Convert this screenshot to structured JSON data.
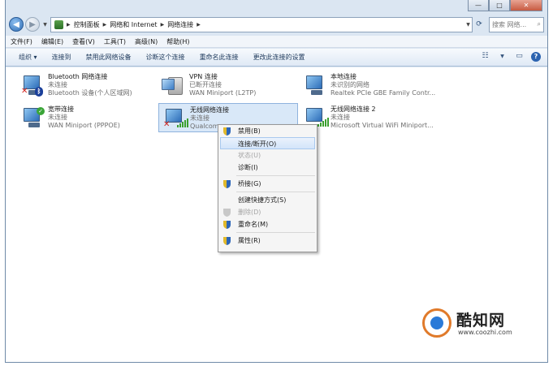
{
  "window": {
    "controls": {
      "minimize": "—",
      "maximize": "□",
      "close": "✕"
    }
  },
  "address": {
    "crumbs": [
      "控制面板",
      "网络和 Internet",
      "网络连接"
    ],
    "search_placeholder": "搜索 网络...",
    "search_icon": "search-icon"
  },
  "menubar": {
    "items": [
      "文件(F)",
      "编辑(E)",
      "查看(V)",
      "工具(T)",
      "高级(N)",
      "帮助(H)"
    ]
  },
  "toolbar": {
    "items": [
      "组织 ▾",
      "连接到",
      "禁用此网络设备",
      "诊断这个连接",
      "重命名此连接",
      "更改此连接的设置"
    ],
    "help": "?"
  },
  "connections": [
    {
      "name": "Bluetooth 网络连接",
      "status": "未连接",
      "device": "Bluetooth 设备(个人区域网)"
    },
    {
      "name": "VPN 连接",
      "status": "已断开连接",
      "device": "WAN Miniport (L2TP)"
    },
    {
      "name": "本地连接",
      "status": "未识别的网络",
      "device": "Realtek PCIe GBE Family Contr..."
    },
    {
      "name": "宽带连接",
      "status": "未连接",
      "device": "WAN Miniport (PPPOE)"
    },
    {
      "name": "无线网络连接",
      "status": "未连接",
      "device": "Qualcomm"
    },
    {
      "name": "无线网络连接 2",
      "status": "未连接",
      "device": "Microsoft Virtual WiFi Miniport..."
    }
  ],
  "context_menu": {
    "items": [
      {
        "label": "禁用(B)",
        "state": "normal"
      },
      {
        "label": "连接/断开(O)",
        "state": "highlighted"
      },
      {
        "label": "状态(U)",
        "state": "disabled"
      },
      {
        "label": "诊断(I)",
        "state": "normal"
      },
      {
        "label": "桥接(G)",
        "state": "normal"
      },
      {
        "label": "创建快捷方式(S)",
        "state": "normal"
      },
      {
        "label": "删除(D)",
        "state": "disabled"
      },
      {
        "label": "重命名(M)",
        "state": "normal"
      },
      {
        "label": "属性(R)",
        "state": "normal"
      }
    ]
  },
  "watermark": {
    "title": "酷知网",
    "url": "www.coozhi.com"
  }
}
